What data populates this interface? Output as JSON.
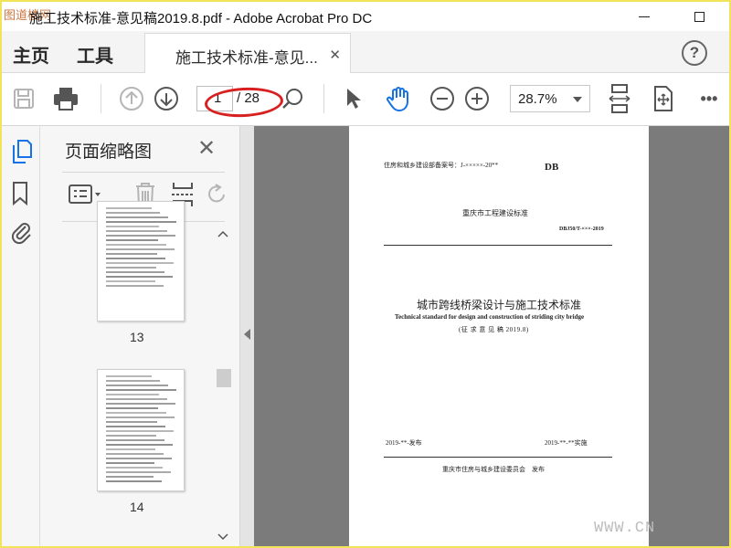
{
  "titlebar": {
    "logo_text": "图道楼网",
    "title": "施工技术标准-意见稿2019.8.pdf - Adobe Acrobat Pro DC"
  },
  "tabs": {
    "home": "主页",
    "tools": "工具",
    "document": "施工技术标准-意见...",
    "close": "✕",
    "help": "?"
  },
  "toolbar": {
    "page_current": "1",
    "page_total": "/ 28",
    "zoom": "28.7%",
    "more": "•••"
  },
  "panel": {
    "title": "页面缩略图",
    "close": "✕",
    "thumbnails": [
      {
        "label": "13"
      },
      {
        "label": "14"
      }
    ]
  },
  "document": {
    "record_no": "住房和城乡建设部备案号：J-×××××-20**",
    "db": "DB",
    "standard_type": "重庆市工程建设标准",
    "code": "DBJ50/T-×××-2019",
    "title_cn": "城市跨线桥梁设计与施工技术标准",
    "title_en": "Technical standard for design and construction of striding city bridge",
    "draft": "(征 求 意 见 稿  2019.8)",
    "publish": "2019-**-发布",
    "implement": "2019-**-**实施",
    "issuer": "重庆市住房与城乡建设委员会　发布"
  },
  "watermark": "WWW.CN",
  "colors": {
    "accent_blue": "#1473e6",
    "annotation_red": "#d82020",
    "frame_yellow": "#f1e35a"
  }
}
